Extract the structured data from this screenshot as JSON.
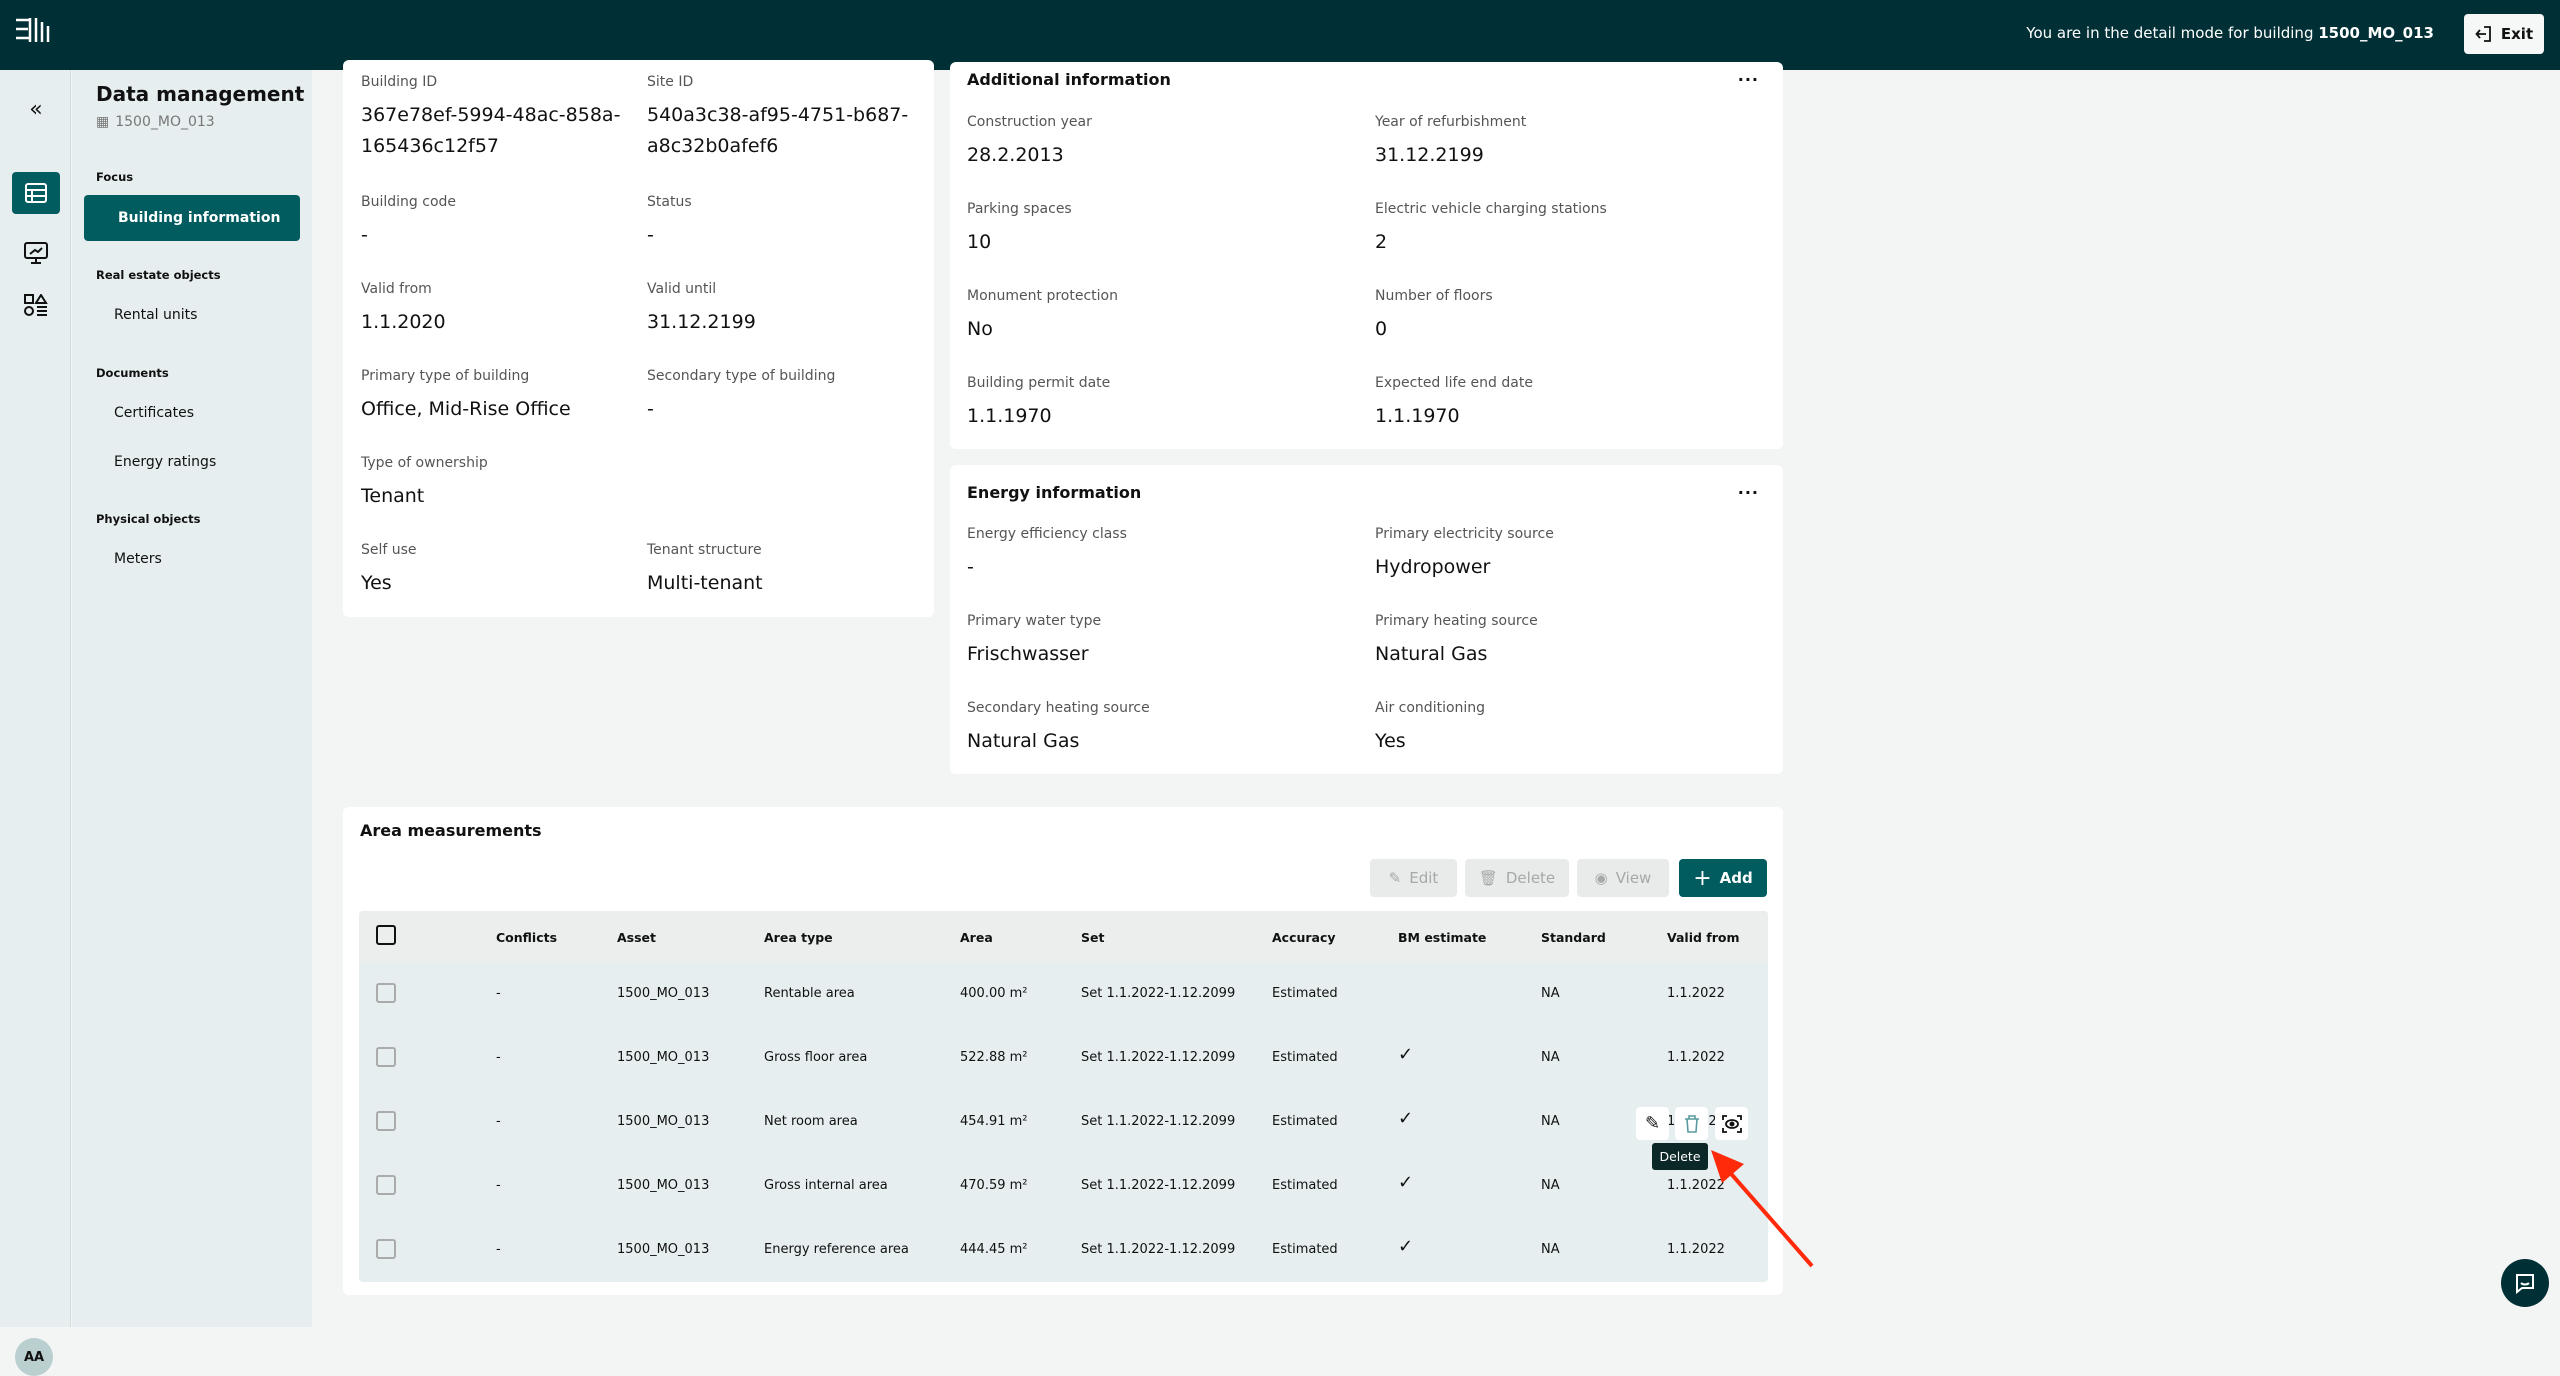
{
  "header": {
    "mode_text": "You are in the detail mode for building",
    "building": "1500_MO_013",
    "exit_label": "Exit"
  },
  "rail": {
    "avatar": "AA"
  },
  "sidebar": {
    "title": "Data management",
    "building": "1500_MO_013",
    "sections": [
      {
        "label": "Focus",
        "items": [
          "Building information"
        ]
      },
      {
        "label": "Real estate objects",
        "items": [
          "Rental units"
        ]
      },
      {
        "label": "Documents",
        "items": [
          "Certificates",
          "Energy ratings"
        ]
      },
      {
        "label": "Physical objects",
        "items": [
          "Meters"
        ]
      }
    ]
  },
  "general": [
    {
      "label": "Building ID",
      "value": "367e78ef-5994-48ac-858a-165436c12f57"
    },
    {
      "label": "Site ID",
      "value": "540a3c38-af95-4751-b687-a8c32b0afef6"
    },
    {
      "label": "Building code",
      "value": "-"
    },
    {
      "label": "Status",
      "value": "-"
    },
    {
      "label": "Valid from",
      "value": "1.1.2020"
    },
    {
      "label": "Valid until",
      "value": "31.12.2199"
    },
    {
      "label": "Primary type of building",
      "value": "Office, Mid-Rise Office"
    },
    {
      "label": "Secondary type of building",
      "value": "-"
    },
    {
      "label": "Type of ownership",
      "value": "Tenant"
    },
    {
      "label": "Self use",
      "value": "Yes"
    },
    {
      "label": "Tenant structure",
      "value": "Multi-tenant"
    }
  ],
  "additional": {
    "title": "Additional information",
    "more": "...",
    "fields": [
      {
        "label": "Construction year",
        "value": "28.2.2013"
      },
      {
        "label": "Year of refurbishment",
        "value": "31.12.2199"
      },
      {
        "label": "Parking spaces",
        "value": "10"
      },
      {
        "label": "Electric vehicle charging stations",
        "value": "2"
      },
      {
        "label": "Monument protection",
        "value": "No"
      },
      {
        "label": "Number of floors",
        "value": "0"
      },
      {
        "label": "Building permit date",
        "value": "1.1.1970"
      },
      {
        "label": "Expected life end date",
        "value": "1.1.1970"
      }
    ]
  },
  "energy": {
    "title": "Energy information",
    "more": "...",
    "fields": [
      {
        "label": "Energy efficiency class",
        "value": "-"
      },
      {
        "label": "Primary electricity source",
        "value": "Hydropower"
      },
      {
        "label": "Primary water type",
        "value": "Frischwasser"
      },
      {
        "label": "Primary heating source",
        "value": "Natural Gas"
      },
      {
        "label": "Secondary heating source",
        "value": "Natural Gas"
      },
      {
        "label": "Air conditioning",
        "value": "Yes"
      }
    ]
  },
  "area": {
    "title": "Area measurements",
    "buttons": {
      "edit": "Edit",
      "delete": "Delete",
      "view": "View",
      "add": "Add"
    },
    "columns": [
      "Conflicts",
      "Asset",
      "Area type",
      "Area",
      "Set",
      "Accuracy",
      "BM estimate",
      "Standard",
      "Valid from"
    ],
    "rows": [
      [
        "-",
        "1500_MO_013",
        "Rentable area",
        "400.00 m²",
        "Set 1.1.2022-1.12.2099",
        "Estimated",
        "",
        "NA",
        "1.1.2022"
      ],
      [
        "-",
        "1500_MO_013",
        "Gross floor area",
        "522.88 m²",
        "Set 1.1.2022-1.12.2099",
        "Estimated",
        "✓",
        "NA",
        "1.1.2022"
      ],
      [
        "-",
        "1500_MO_013",
        "Net room area",
        "454.91 m²",
        "Set 1.1.2022-1.12.2099",
        "Estimated",
        "✓",
        "NA",
        "1.1.2022"
      ],
      [
        "-",
        "1500_MO_013",
        "Gross internal area",
        "470.59 m²",
        "Set 1.1.2022-1.12.2099",
        "Estimated",
        "✓",
        "NA",
        "1.1.2022"
      ],
      [
        "-",
        "1500_MO_013",
        "Energy reference area",
        "444.45 m²",
        "Set 1.1.2022-1.12.2099",
        "Estimated",
        "✓",
        "NA",
        "1.1.2022"
      ]
    ],
    "tooltip": "Delete"
  },
  "colors": {
    "topbar": "#003035",
    "accent": "#005c5f",
    "arrow": "#ff2a0a"
  }
}
